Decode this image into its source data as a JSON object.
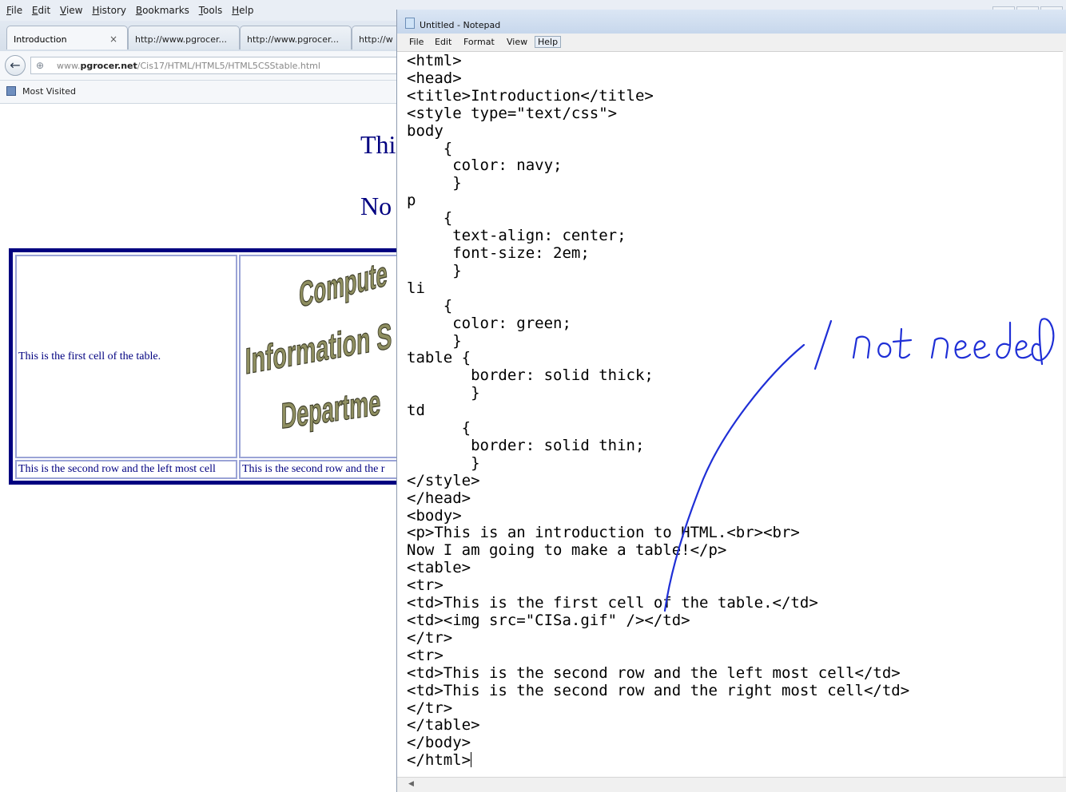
{
  "browser": {
    "menu": [
      "File",
      "Edit",
      "View",
      "History",
      "Bookmarks",
      "Tools",
      "Help"
    ],
    "tabs": [
      {
        "label": "Introduction",
        "close": "×"
      },
      {
        "label": "http://www.pgrocer..."
      },
      {
        "label": "http://www.pgrocer..."
      },
      {
        "label": "http://w"
      }
    ],
    "url_prefix": "www.",
    "url_domain": "pgrocer.net",
    "url_path": "/Cis17/HTML/HTML5/HTML5CSStable.html",
    "bookmark": "Most Visited",
    "page": {
      "line1": "Thi",
      "line2": "No",
      "cell_1_1": "This is the first cell of the table.",
      "cell_2_1": "This is the second row and the left most cell",
      "cell_2_2": "This is the second row and the r"
    }
  },
  "notepad": {
    "title": "Untitled - Notepad",
    "menu": [
      "File",
      "Edit",
      "Format",
      "View",
      "Help"
    ],
    "code": "<html>\n<head>\n<title>Introduction</title>\n<style type=\"text/css\">\nbody\n    {\n     color: navy;\n     }\np\n    {\n     text-align: center;\n     font-size: 2em;\n     }\nli\n    {\n     color: green;\n     }\ntable {\n       border: solid thick;\n       }\ntd\n      {\n       border: solid thin;\n       }\n</style>\n</head>\n<body>\n<p>This is an introduction to HTML.<br><br>\nNow I am going to make a table!</p>\n<table>\n<tr>\n<td>This is the first cell of the table.</td>\n<td><img src=\"CISa.gif\" /></td>\n</tr>\n<tr>\n<td>This is the second row and the left most cell</td>\n<td>This is the second row and the right most cell</td>\n</tr>\n</table>\n</body>\n</html>"
  },
  "annotation": {
    "text": "/ not needed",
    "color": "#1f2fd6"
  },
  "colors": {
    "page_text": "#000080",
    "table_border": "#000080",
    "cell_border": "#9aa3d6"
  }
}
